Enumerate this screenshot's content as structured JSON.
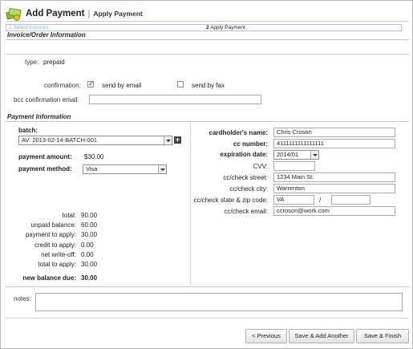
{
  "window": {
    "title": "Add Payment",
    "subtitle": "Apply Payment",
    "icon": "money-icon"
  },
  "steps": [
    {
      "num": "1",
      "label": "Select Invoices"
    },
    {
      "num": "2",
      "label": "Apply Payment"
    }
  ],
  "invoice_section": {
    "heading": "Invoice/Order Information",
    "type_label": "type:",
    "type_value": "prepaid",
    "confirmation_label": "confirmation:",
    "send_email_label": "send by email",
    "send_email_checked": "✓",
    "send_fax_label": "send by fax",
    "bcc_label": "bcc confirmation email:",
    "bcc_value": ""
  },
  "payment_section": {
    "heading": "Payment Information",
    "batch_label": "batch:",
    "batch_value": "AV: 2013-02-14-BATCH-001",
    "add_batch": "+",
    "amount_label": "payment amount:",
    "amount_value": "$30.00",
    "method_label": "payment method:",
    "method_value": "Visa",
    "summary": [
      {
        "label": "total:",
        "value": "90.00"
      },
      {
        "label": "unpaid balance:",
        "value": "60.00"
      },
      {
        "label": "payment to apply:",
        "value": "30.00"
      },
      {
        "label": "credit to apply:",
        "value": "0.00"
      },
      {
        "label": "net write-off:",
        "value": "0.00"
      },
      {
        "label": "total to apply:",
        "value": "30.00"
      }
    ],
    "new_balance_label": "new balance due:",
    "new_balance_value": "30.00"
  },
  "card": {
    "holder_label": "cardholder's name:",
    "holder_value": "Chris Croson",
    "number_label": "cc number:",
    "number_value": "4111111111111111",
    "exp_label": "expiration date:",
    "exp_value": "2014/01",
    "cvv_label": "CVV:",
    "cvv_value": "",
    "street_label": "cc/check street:",
    "street_value": "1234 Main St.",
    "city_label": "cc/check city:",
    "city_value": "Warrenton",
    "state_zip_label": "cc/check state & zip code:",
    "state_value": "VA",
    "zip_sep": "/",
    "zip_value": "",
    "email_label": "cc/check email:",
    "email_value": "ccroson@work.com"
  },
  "notes": {
    "label": "notes:",
    "value": ""
  },
  "buttons": {
    "previous": "< Previous",
    "save_add": "Save & Add Another",
    "save_finish": "Save & Finish"
  }
}
